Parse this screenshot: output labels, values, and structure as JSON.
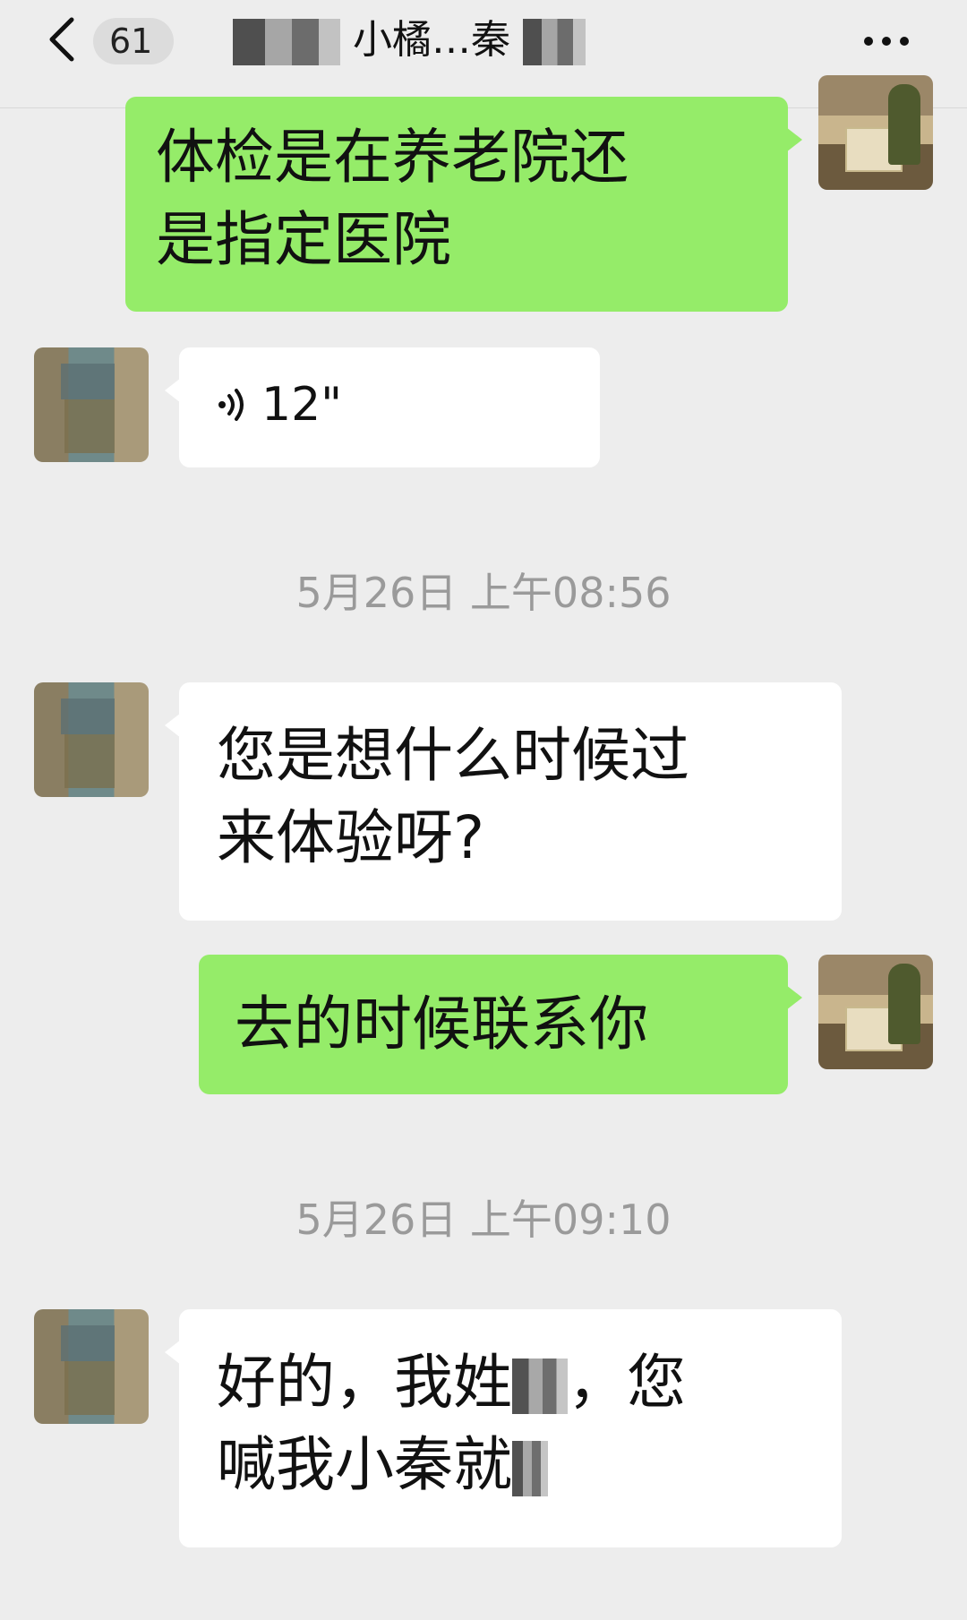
{
  "topbar": {
    "unread_count": "61",
    "title": "小橘…秦"
  },
  "messages": [
    {
      "side": "right",
      "type": "text",
      "lines": [
        "体检是在养老院还",
        "是指定医院"
      ]
    },
    {
      "side": "left",
      "type": "voice",
      "duration": "12\""
    },
    {
      "type": "time",
      "text": "5月26日 上午08:56"
    },
    {
      "side": "left",
      "type": "text",
      "lines": [
        "您是想什么时候过",
        "来体验呀?"
      ]
    },
    {
      "side": "right",
      "type": "text",
      "lines": [
        "去的时候联系你"
      ]
    },
    {
      "type": "time",
      "text": "5月26日 上午09:10"
    },
    {
      "side": "left",
      "type": "text",
      "lines": [
        "好的，我姓",
        "，您",
        "喊我小秦就"
      ]
    }
  ],
  "colors": {
    "background": "#ededed",
    "self_bubble": "#95ec69",
    "other_bubble": "#ffffff",
    "timestamp": "#9a9a9a"
  },
  "icons": [
    "chevron-left-icon",
    "more-dots-icon",
    "voice-wave-icon"
  ]
}
